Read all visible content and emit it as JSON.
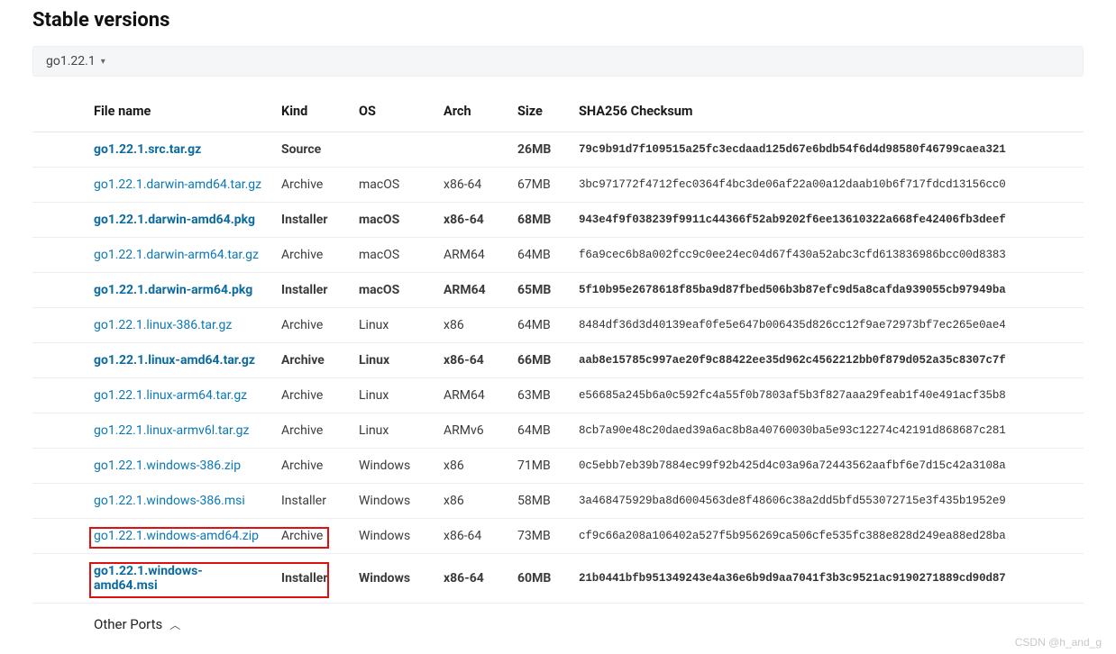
{
  "title": "Stable versions",
  "version": "go1.22.1",
  "headers": {
    "file": "File name",
    "kind": "Kind",
    "os": "OS",
    "arch": "Arch",
    "size": "Size",
    "sha": "SHA256 Checksum"
  },
  "rows": [
    {
      "file": "go1.22.1.src.tar.gz",
      "kind": "Source",
      "os": "",
      "arch": "",
      "size": "26MB",
      "sha": "79c9b91d7f109515a25fc3ecdaad125d67e6bdb54f6d4d98580f46799caea321",
      "bold": true,
      "highlight": false
    },
    {
      "file": "go1.22.1.darwin-amd64.tar.gz",
      "kind": "Archive",
      "os": "macOS",
      "arch": "x86-64",
      "size": "67MB",
      "sha": "3bc971772f4712fec0364f4bc3de06af22a00a12daab10b6f717fdcd13156cc0",
      "bold": false,
      "highlight": false
    },
    {
      "file": "go1.22.1.darwin-amd64.pkg",
      "kind": "Installer",
      "os": "macOS",
      "arch": "x86-64",
      "size": "68MB",
      "sha": "943e4f9f038239f9911c44366f52ab9202f6ee13610322a668fe42406fb3deef",
      "bold": true,
      "highlight": false
    },
    {
      "file": "go1.22.1.darwin-arm64.tar.gz",
      "kind": "Archive",
      "os": "macOS",
      "arch": "ARM64",
      "size": "64MB",
      "sha": "f6a9cec6b8a002fcc9c0ee24ec04d67f430a52abc3cfd613836986bcc00d8383",
      "bold": false,
      "highlight": false
    },
    {
      "file": "go1.22.1.darwin-arm64.pkg",
      "kind": "Installer",
      "os": "macOS",
      "arch": "ARM64",
      "size": "65MB",
      "sha": "5f10b95e2678618f85ba9d87fbed506b3b87efc9d5a8cafda939055cb97949ba",
      "bold": true,
      "highlight": false
    },
    {
      "file": "go1.22.1.linux-386.tar.gz",
      "kind": "Archive",
      "os": "Linux",
      "arch": "x86",
      "size": "64MB",
      "sha": "8484df36d3d40139eaf0fe5e647b006435d826cc12f9ae72973bf7ec265e0ae4",
      "bold": false,
      "highlight": false
    },
    {
      "file": "go1.22.1.linux-amd64.tar.gz",
      "kind": "Archive",
      "os": "Linux",
      "arch": "x86-64",
      "size": "66MB",
      "sha": "aab8e15785c997ae20f9c88422ee35d962c4562212bb0f879d052a35c8307c7f",
      "bold": true,
      "highlight": false
    },
    {
      "file": "go1.22.1.linux-arm64.tar.gz",
      "kind": "Archive",
      "os": "Linux",
      "arch": "ARM64",
      "size": "63MB",
      "sha": "e56685a245b6a0c592fc4a55f0b7803af5b3f827aaa29feab1f40e491acf35b8",
      "bold": false,
      "highlight": false
    },
    {
      "file": "go1.22.1.linux-armv6l.tar.gz",
      "kind": "Archive",
      "os": "Linux",
      "arch": "ARMv6",
      "size": "64MB",
      "sha": "8cb7a90e48c20daed39a6ac8b8a40760030ba5e93c12274c42191d868687c281",
      "bold": false,
      "highlight": false
    },
    {
      "file": "go1.22.1.windows-386.zip",
      "kind": "Archive",
      "os": "Windows",
      "arch": "x86",
      "size": "71MB",
      "sha": "0c5ebb7eb39b7884ec99f92b425d4c03a96a72443562aafbf6e7d15c42a3108a",
      "bold": false,
      "highlight": false
    },
    {
      "file": "go1.22.1.windows-386.msi",
      "kind": "Installer",
      "os": "Windows",
      "arch": "x86",
      "size": "58MB",
      "sha": "3a468475929ba8d6004563de8f48606c38a2dd5bfd553072715e3f435b1952e9",
      "bold": false,
      "highlight": false
    },
    {
      "file": "go1.22.1.windows-amd64.zip",
      "kind": "Archive",
      "os": "Windows",
      "arch": "x86-64",
      "size": "73MB",
      "sha": "cf9c66a208a106402a527f5b956269ca506cfe535fc388e828d249ea88ed28ba",
      "bold": false,
      "highlight": true
    },
    {
      "file": "go1.22.1.windows-amd64.msi",
      "kind": "Installer",
      "os": "Windows",
      "arch": "x86-64",
      "size": "60MB",
      "sha": "21b0441bfb951349243e4a36e6b9d9aa7041f3b3c9521ac9190271889cd90d87",
      "bold": true,
      "highlight": true
    }
  ],
  "other_ports": "Other Ports",
  "watermark": "CSDN @h_and_g"
}
